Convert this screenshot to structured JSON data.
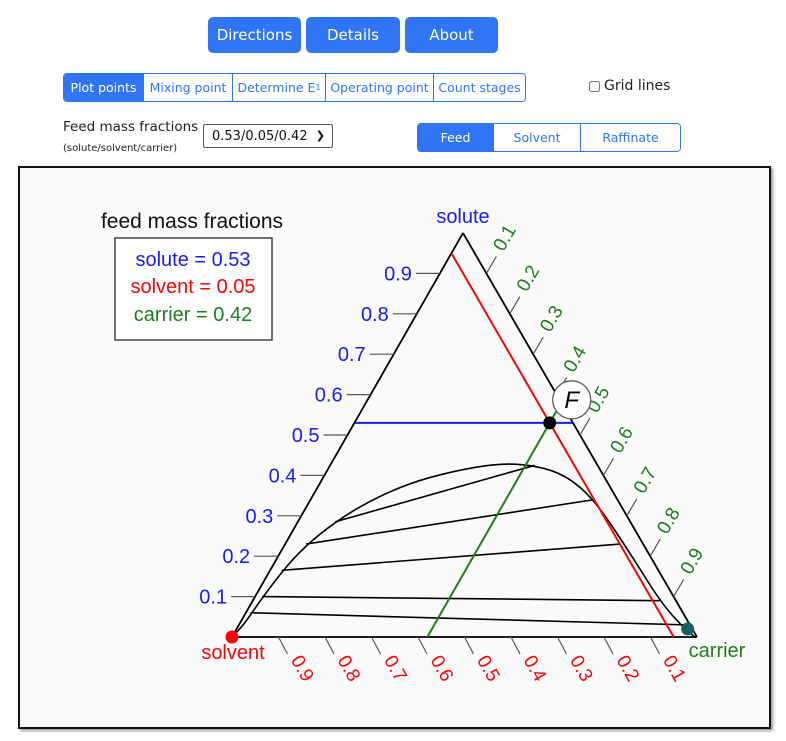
{
  "header": {
    "buttons": [
      {
        "label": "Directions"
      },
      {
        "label": "Details"
      },
      {
        "label": "About"
      }
    ]
  },
  "tabs": [
    {
      "label": "Plot points",
      "active": true
    },
    {
      "label": "Mixing point",
      "active": false
    },
    {
      "label": "Determine E",
      "sub": "1",
      "active": false
    },
    {
      "label": "Operating point",
      "active": false
    },
    {
      "label": "Count stages",
      "active": false
    }
  ],
  "grid_lines": {
    "label": "Grid lines",
    "checked": false
  },
  "feed_select": {
    "label": "Feed mass fractions",
    "sublabel": "(solute/solvent/carrier)",
    "value": "0.53/0.05/0.42"
  },
  "point_buttons": [
    {
      "label": "Feed",
      "active": true
    },
    {
      "label": "Solvent",
      "active": false
    },
    {
      "label": "Raffinate",
      "active": false
    }
  ],
  "colors": {
    "accent": "#2f75f6",
    "solute": "#1a1aff",
    "solvent": "#ff0000",
    "carrier": "#1e7d1e",
    "carrier_point": "#176060"
  },
  "chart_data": {
    "type": "ternary",
    "legend_title": "feed mass fractions",
    "legend": [
      {
        "text": "solute = 0.53",
        "color": "#1a1aff"
      },
      {
        "text": "solvent = 0.05",
        "color": "#ff0000"
      },
      {
        "text": "carrier = 0.42",
        "color": "#1e7d1e"
      }
    ],
    "corners": {
      "top": "solute",
      "left": "solvent",
      "right": "carrier"
    },
    "axis_ticks": [
      0.1,
      0.2,
      0.3,
      0.4,
      0.5,
      0.6,
      0.7,
      0.8,
      0.9
    ],
    "feed_point": {
      "label": "F",
      "solute": 0.53,
      "solvent": 0.05,
      "carrier": 0.42
    },
    "solvent_point": {
      "solute": 0.0,
      "solvent": 1.0,
      "carrier": 0.0
    },
    "carrier_point": {
      "solute": 0.02,
      "solvent": 0.01,
      "carrier": 0.97
    },
    "binodal_curve": [
      {
        "solute": 0.0,
        "carrier": 0.0
      },
      {
        "solute": 0.03,
        "carrier": 0.01
      },
      {
        "solute": 0.08,
        "carrier": 0.015
      },
      {
        "solute": 0.15,
        "carrier": 0.025
      },
      {
        "solute": 0.21,
        "carrier": 0.04
      },
      {
        "solute": 0.27,
        "carrier": 0.07
      },
      {
        "solute": 0.33,
        "carrier": 0.12
      },
      {
        "solute": 0.38,
        "carrier": 0.19
      },
      {
        "solute": 0.41,
        "carrier": 0.27
      },
      {
        "solute": 0.43,
        "carrier": 0.36
      },
      {
        "solute": 0.425,
        "carrier": 0.44
      },
      {
        "solute": 0.4,
        "carrier": 0.52
      },
      {
        "solute": 0.34,
        "carrier": 0.61
      },
      {
        "solute": 0.22,
        "carrier": 0.74
      },
      {
        "solute": 0.09,
        "carrier": 0.875
      },
      {
        "solute": 0.03,
        "carrier": 0.95
      },
      {
        "solute": 0.0,
        "carrier": 0.995
      }
    ],
    "tie_lines": [
      {
        "extract": {
          "solute": 0.06,
          "carrier": 0.01
        },
        "raffinate": {
          "solute": 0.03,
          "carrier": 0.96
        }
      },
      {
        "extract": {
          "solute": 0.1,
          "carrier": 0.015
        },
        "raffinate": {
          "solute": 0.09,
          "carrier": 0.875
        }
      },
      {
        "extract": {
          "solute": 0.165,
          "carrier": 0.025
        },
        "raffinate": {
          "solute": 0.23,
          "carrier": 0.72
        }
      },
      {
        "extract": {
          "solute": 0.23,
          "carrier": 0.045
        },
        "raffinate": {
          "solute": 0.34,
          "carrier": 0.61
        }
      },
      {
        "extract": {
          "solute": 0.285,
          "carrier": 0.08
        },
        "raffinate": {
          "solute": 0.425,
          "carrier": 0.44
        }
      }
    ]
  }
}
